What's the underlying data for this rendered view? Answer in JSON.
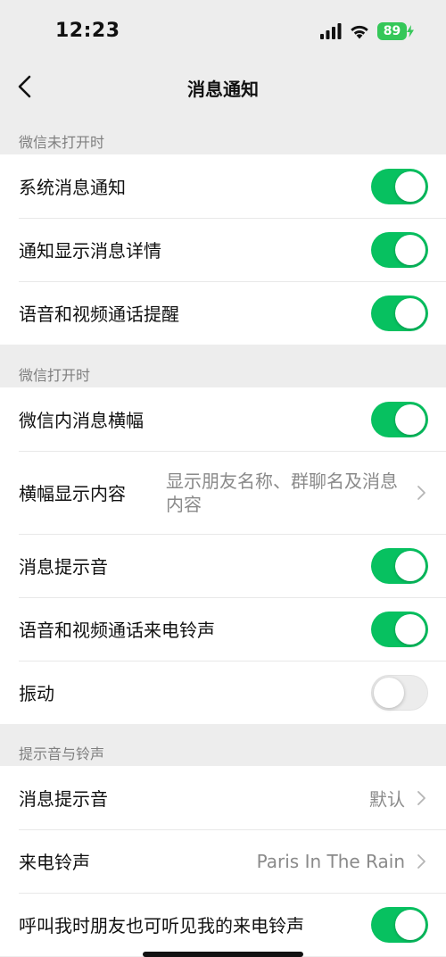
{
  "status_bar": {
    "time": "12:23",
    "battery": "89",
    "icons": [
      "signal-icon",
      "wifi-icon",
      "battery-icon"
    ]
  },
  "nav": {
    "title": "消息通知",
    "back_icon": "chevron-left-icon"
  },
  "sections": [
    {
      "header": "微信未打开时",
      "rows": [
        {
          "label": "系统消息通知",
          "toggle": true
        },
        {
          "label": "通知显示消息详情",
          "toggle": true
        },
        {
          "label": "语音和视频通话提醒",
          "toggle": true
        }
      ]
    },
    {
      "header": "微信打开时",
      "rows": [
        {
          "label": "微信内消息横幅",
          "toggle": true
        },
        {
          "label": "横幅显示内容",
          "value": "显示朋友名称、群聊名及消息内容"
        },
        {
          "label": "消息提示音",
          "toggle": true
        },
        {
          "label": "语音和视频通话来电铃声",
          "toggle": true
        },
        {
          "label": "振动",
          "toggle": false
        }
      ]
    },
    {
      "header": "提示音与铃声",
      "rows": [
        {
          "label": "消息提示音",
          "value": "默认"
        },
        {
          "label": "来电铃声",
          "value": "Paris In The Rain"
        },
        {
          "label": "呼叫我时朋友也可听见我的来电铃声",
          "toggle": true
        }
      ]
    }
  ],
  "colors": {
    "background": "#ededed",
    "toggle_on": "#07c160",
    "toggle_off": "#ececec",
    "battery": "#35c759"
  }
}
